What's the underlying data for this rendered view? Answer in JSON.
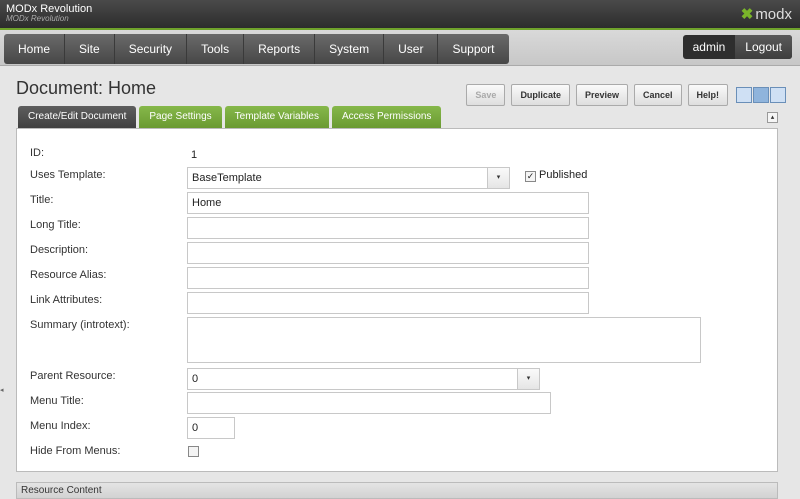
{
  "app": {
    "brand": "MODx Revolution",
    "brand_sub": "MODx Revolution",
    "logo_text": "modx",
    "logo_mark": "✖"
  },
  "nav": {
    "items": [
      "Home",
      "Site",
      "Security",
      "Tools",
      "Reports",
      "System",
      "User",
      "Support"
    ],
    "user": "admin",
    "logout": "Logout"
  },
  "page": {
    "title": "Document: Home"
  },
  "toolbar": {
    "save": "Save",
    "duplicate": "Duplicate",
    "preview": "Preview",
    "cancel": "Cancel",
    "help": "Help!"
  },
  "tabs": [
    "Create/Edit Document",
    "Page Settings",
    "Template Variables",
    "Access Permissions"
  ],
  "form": {
    "id_label": "ID:",
    "id_value": "1",
    "template_label": "Uses Template:",
    "template_value": "BaseTemplate",
    "published_label": "Published",
    "published_checked": "✓",
    "title_label": "Title:",
    "title_value": "Home",
    "longtitle_label": "Long Title:",
    "longtitle_value": "",
    "description_label": "Description:",
    "description_value": "",
    "alias_label": "Resource Alias:",
    "alias_value": "",
    "link_attr_label": "Link Attributes:",
    "link_attr_value": "",
    "summary_label": "Summary (introtext):",
    "summary_value": "",
    "parent_label": "Parent Resource:",
    "parent_value": "0",
    "menu_title_label": "Menu Title:",
    "menu_title_value": "",
    "menu_index_label": "Menu Index:",
    "menu_index_value": "0",
    "hide_menus_label": "Hide From Menus:"
  },
  "section": {
    "resource_content": "Resource Content"
  },
  "icons": {
    "combo_arrow": "▾",
    "collapse": "▴",
    "side_handle": "◂"
  }
}
